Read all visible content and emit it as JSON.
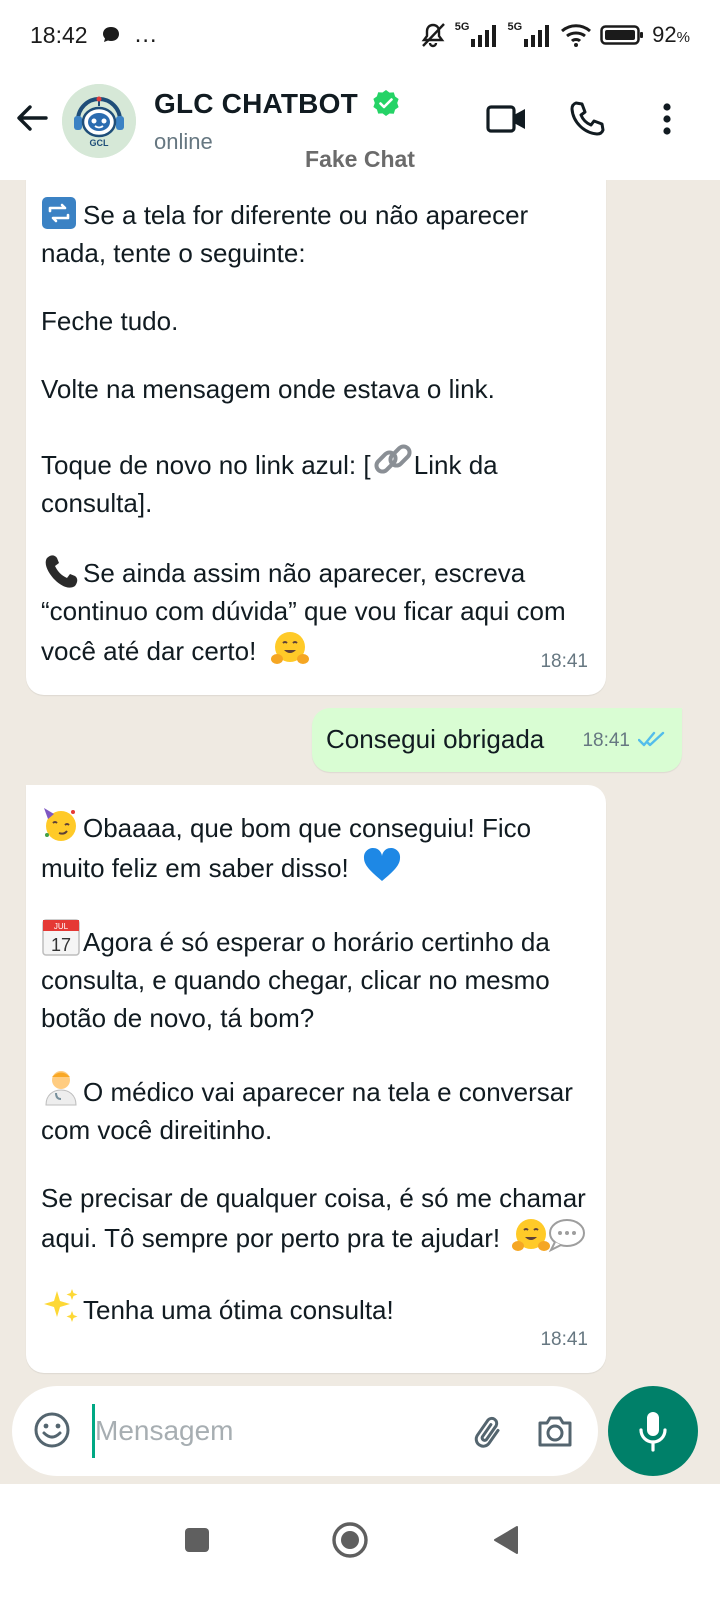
{
  "status_bar": {
    "time": "18:42",
    "more": "…",
    "net1": "5G",
    "net2": "5G",
    "battery": "92",
    "battery_unit": "%"
  },
  "header": {
    "avatar_text": "GCL",
    "name": "GLC CHATBOT",
    "status": "online",
    "subtitle": "Fake Chat",
    "icons": [
      "back-arrow-icon",
      "video-call-icon",
      "phone-icon",
      "more-vert-icon"
    ]
  },
  "messages": [
    {
      "direction": "in",
      "time": "18:41",
      "paragraphs": [
        {
          "emoji": "repeat-icon",
          "text": "Se a tela for diferente ou não aparecer nada, tente o seguinte:"
        },
        {
          "text": "Feche tudo."
        },
        {
          "text": "Volte na mensagem onde estava o link."
        },
        {
          "pre": "Toque de novo no link azul: [",
          "emoji": "link-icon",
          "text": " Link da consulta]."
        },
        {
          "emoji": "telephone-icon",
          "text": "Se ainda assim não aparecer, escreva “continuo com dúvida” que vou ficar aqui com você até dar certo!",
          "trail_emoji": "hugging-face-icon"
        }
      ]
    },
    {
      "direction": "out",
      "time": "18:41",
      "text": "Consegui obrigada",
      "status_icon": "double-check-read-icon"
    },
    {
      "direction": "in",
      "time": "18:41",
      "paragraphs": [
        {
          "emoji": "party-face-icon",
          "text": "Obaaaa, que bom que conseguiu! Fico muito feliz em saber disso!",
          "trail_emoji": "blue-heart-icon"
        },
        {
          "emoji": "calendar-icon",
          "text": "Agora é só esperar o horário certinho da consulta, e quando chegar, clicar no mesmo botão de novo, tá bom?"
        },
        {
          "emoji": "doctor-icon",
          "text": "O médico vai aparecer na tela e conversar com você direitinho."
        },
        {
          "text": "Se precisar de qualquer coisa, é só me chamar aqui. Tô sempre por perto pra te ajudar!",
          "trail_emoji": "hugging-face-icon"
        },
        {
          "emoji": "sparkles-icon",
          "text": "Tenha uma ótima consulta!"
        }
      ],
      "calendar_month": "JUL",
      "calendar_day": "17"
    }
  ],
  "composer": {
    "placeholder": "Mensagem",
    "value": ""
  },
  "colors": {
    "accent": "#008069",
    "verified": "#25d366",
    "outgoing_bubble": "#d9fdd3",
    "chat_bg": "#efeae2",
    "read_ticks": "#53bdeb"
  }
}
